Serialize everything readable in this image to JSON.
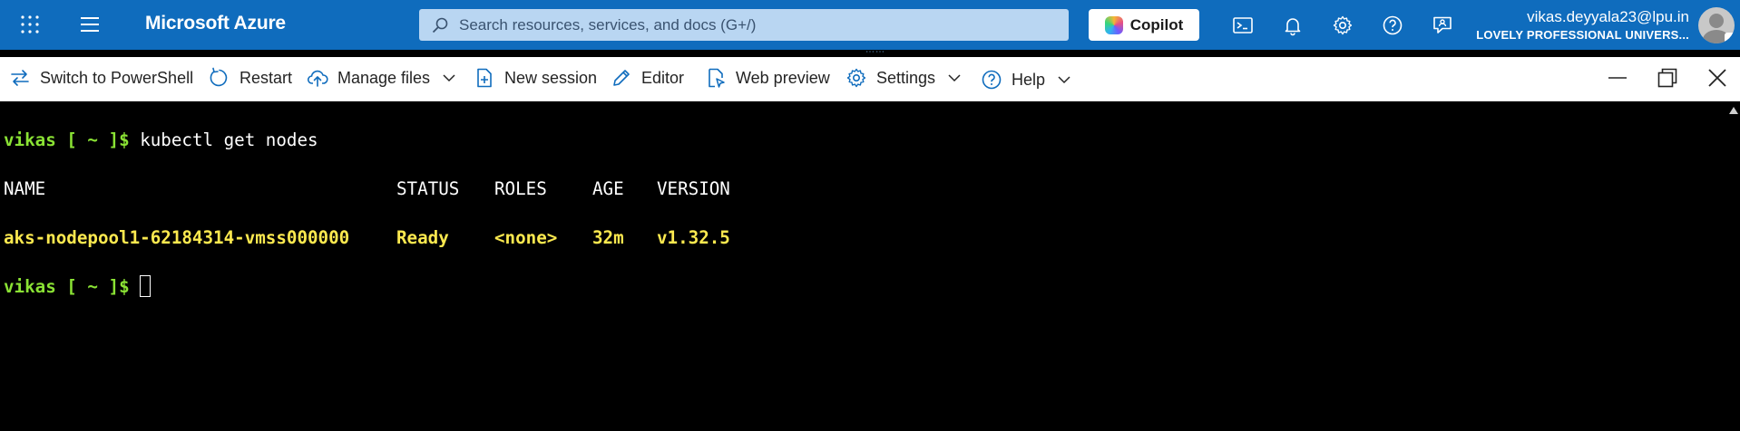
{
  "header": {
    "brand": "Microsoft Azure",
    "search_placeholder": "Search resources, services, and docs (G+/)",
    "copilot_label": "Copilot",
    "user_email": "vikas.deyyala23@lpu.in",
    "user_org": "LOVELY PROFESSIONAL UNIVERS...",
    "accent_color": "#0f6cbd"
  },
  "toolbar": {
    "switch_label": "Switch to PowerShell",
    "restart_label": "Restart",
    "manage_files_label": "Manage files",
    "new_session_label": "New session",
    "editor_label": "Editor",
    "web_preview_label": "Web preview",
    "settings_label": "Settings",
    "help_label": "Help"
  },
  "terminal": {
    "prompt": "vikas [ ~ ]$",
    "command": "kubectl get nodes",
    "headers": {
      "name": "NAME",
      "status": "STATUS",
      "roles": "ROLES",
      "age": "AGE",
      "version": "VERSION"
    },
    "row": {
      "name": "aks-nodepool1-62184314-vmss000000",
      "status": "Ready",
      "roles": "<none>",
      "age": "32m",
      "version": "v1.32.5"
    },
    "prompt_color": "#8ae234",
    "output_color": "#fce94f"
  }
}
